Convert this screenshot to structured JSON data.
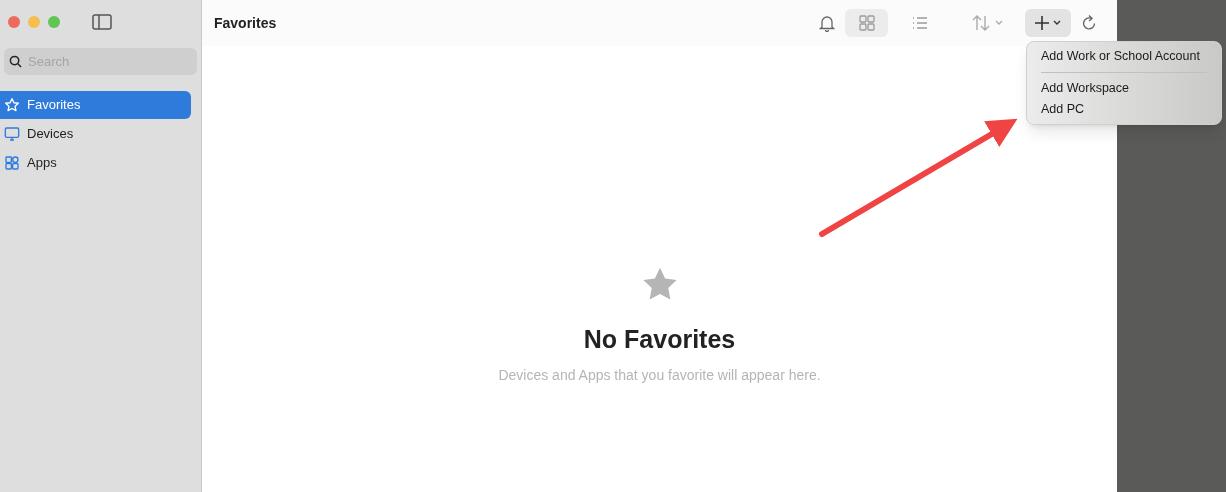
{
  "sidebar": {
    "search": {
      "placeholder": "Search"
    },
    "items": [
      {
        "label": "Favorites",
        "kind": "star",
        "selected": true
      },
      {
        "label": "Devices",
        "kind": "monitor",
        "selected": false
      },
      {
        "label": "Apps",
        "kind": "apps",
        "selected": false
      }
    ]
  },
  "toolbar": {
    "title": "Favorites",
    "views": [
      {
        "kind": "grid",
        "selected": true
      },
      {
        "kind": "list",
        "selected": false
      }
    ],
    "add_open": true
  },
  "menu": {
    "items": [
      {
        "label": "Add Work or School Account",
        "separator_after": true
      },
      {
        "label": "Add Workspace",
        "separator_after": false
      },
      {
        "label": "Add PC",
        "separator_after": false
      }
    ]
  },
  "empty": {
    "title": "No Favorites",
    "message": "Devices and Apps that you favorite will appear here."
  }
}
